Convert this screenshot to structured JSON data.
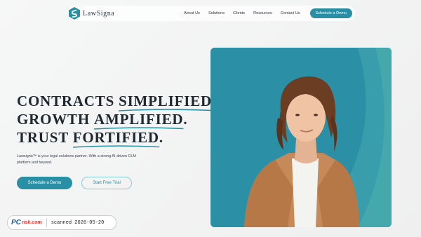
{
  "brand": {
    "name": "LawSigna",
    "accent": "#2a8fa4"
  },
  "nav": {
    "items": [
      "About Us",
      "Solutions",
      "Clients",
      "Resources",
      "Contact Us"
    ],
    "cta": "Schedule a Demo"
  },
  "hero": {
    "headline": [
      {
        "before": "CONTRACTS ",
        "highlight": "SIMPLIFIED",
        "after": "."
      },
      {
        "before": "GROWTH ",
        "highlight": "AMPLIFIED",
        "after": "."
      },
      {
        "before": "TRUST ",
        "highlight": "FORTIFIED",
        "after": "."
      }
    ],
    "description": "Lawsigna™ is your legal solutions partner. With a strong AI-driven CLM platform and beyond.",
    "primary_button": "Schedule a Demo",
    "secondary_button": "Start Free Trial",
    "image": "man-portrait"
  },
  "watermark": {
    "logo_main": "PC",
    "logo_sub": "risk.com",
    "text": "scanned 2026-05-20"
  }
}
